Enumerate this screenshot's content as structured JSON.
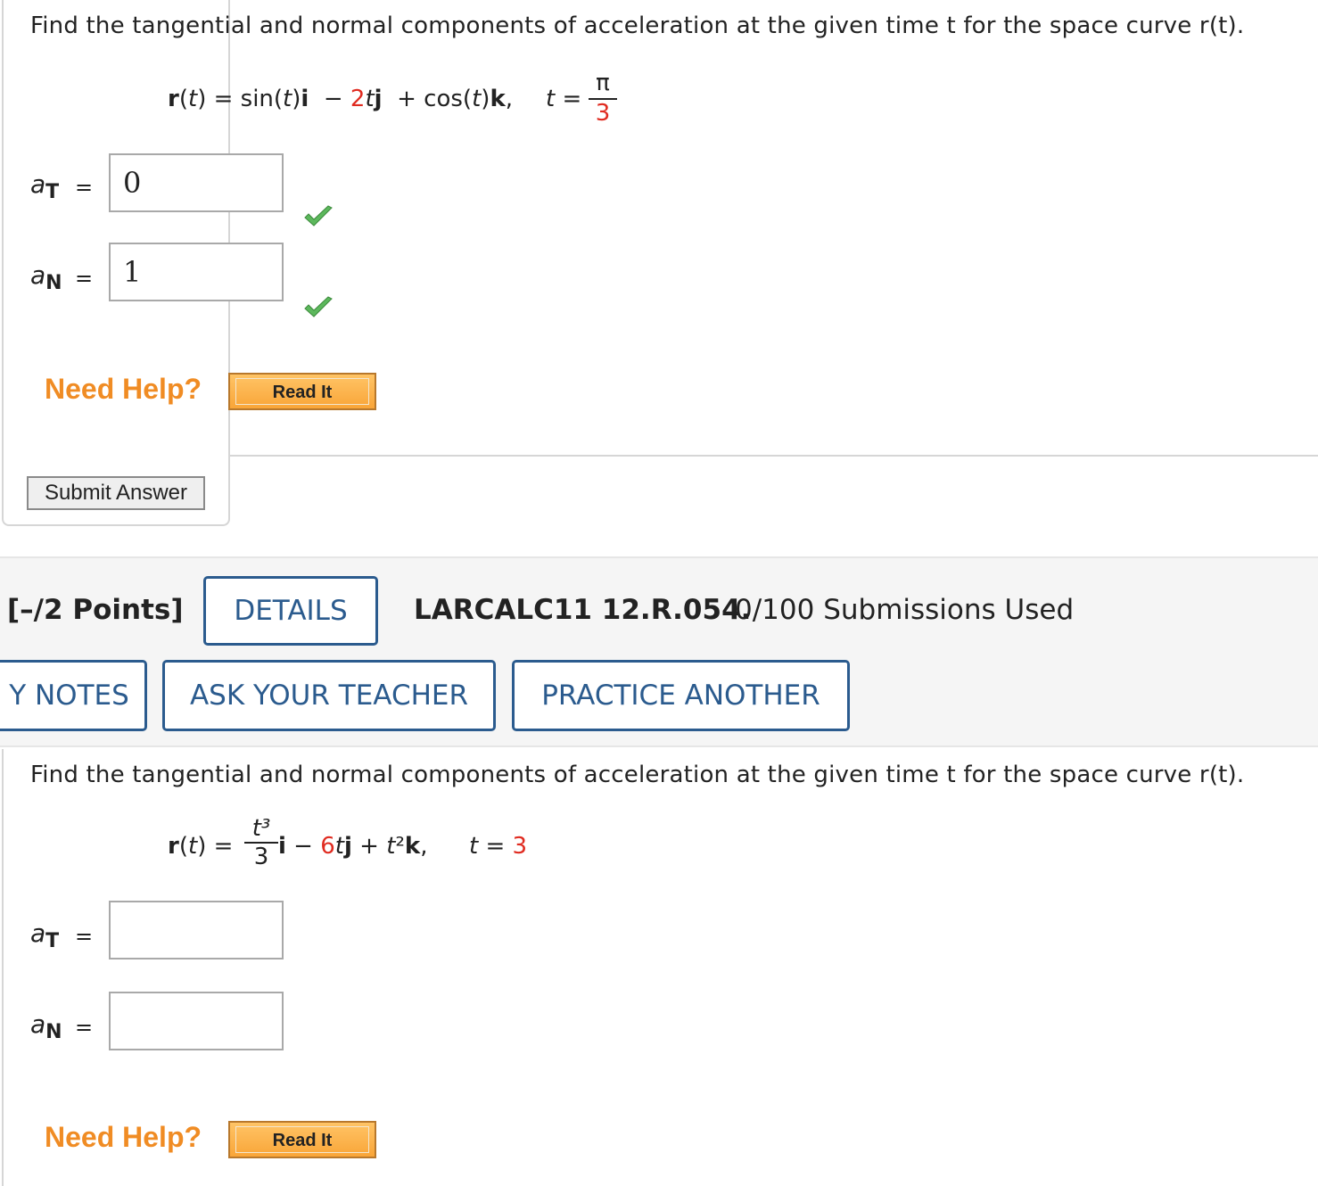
{
  "problem1": {
    "prompt": "Find the tangential and normal components of acceleration at the given time t for the space curve r(t).",
    "equation": {
      "lhs": "r(t) =",
      "t1": "sin(t)i",
      "minus": "−",
      "coef": "2",
      "t2": "tj",
      "plus": "+",
      "t3": "cos(t)k,",
      "t_label": "t =",
      "t_num": "π",
      "t_den": "3"
    },
    "aT_label": "a",
    "aT_sub": "T",
    "aN_label": "a",
    "aN_sub": "N",
    "equals": "=",
    "aT_value": "0",
    "aN_value": "1",
    "aT_correct": true,
    "aN_correct": true,
    "need_help": "Need Help?",
    "read_it": "Read It",
    "submit": "Submit Answer"
  },
  "problem2_header": {
    "points": "[–/2 Points]",
    "details": "DETAILS",
    "code": "LARCALC11 12.R.054.",
    "submissions": "0/100 Submissions Used",
    "my_notes": "Y NOTES",
    "ask_teacher": "ASK YOUR TEACHER",
    "practice": "PRACTICE ANOTHER"
  },
  "problem2": {
    "prompt": "Find the tangential and normal components of acceleration at the given time t for the space curve r(t).",
    "equation": {
      "lhs": "r(t) =",
      "frac_num": "t³",
      "frac_den": "3",
      "t1": "i",
      "minus": "−",
      "coef": "6",
      "t2": "tj + t²k,",
      "t_label": "t =",
      "t_value": "3"
    },
    "aT_label": "a",
    "aT_sub": "T",
    "aN_label": "a",
    "aN_sub": "N",
    "equals": "=",
    "aT_value": "",
    "aN_value": "",
    "need_help": "Need Help?",
    "read_it": "Read It"
  },
  "colors": {
    "accent_blue": "#2b5b8e",
    "highlight_red": "#e02b20",
    "help_orange": "#f08c24",
    "check_green": "#5cb85c"
  }
}
